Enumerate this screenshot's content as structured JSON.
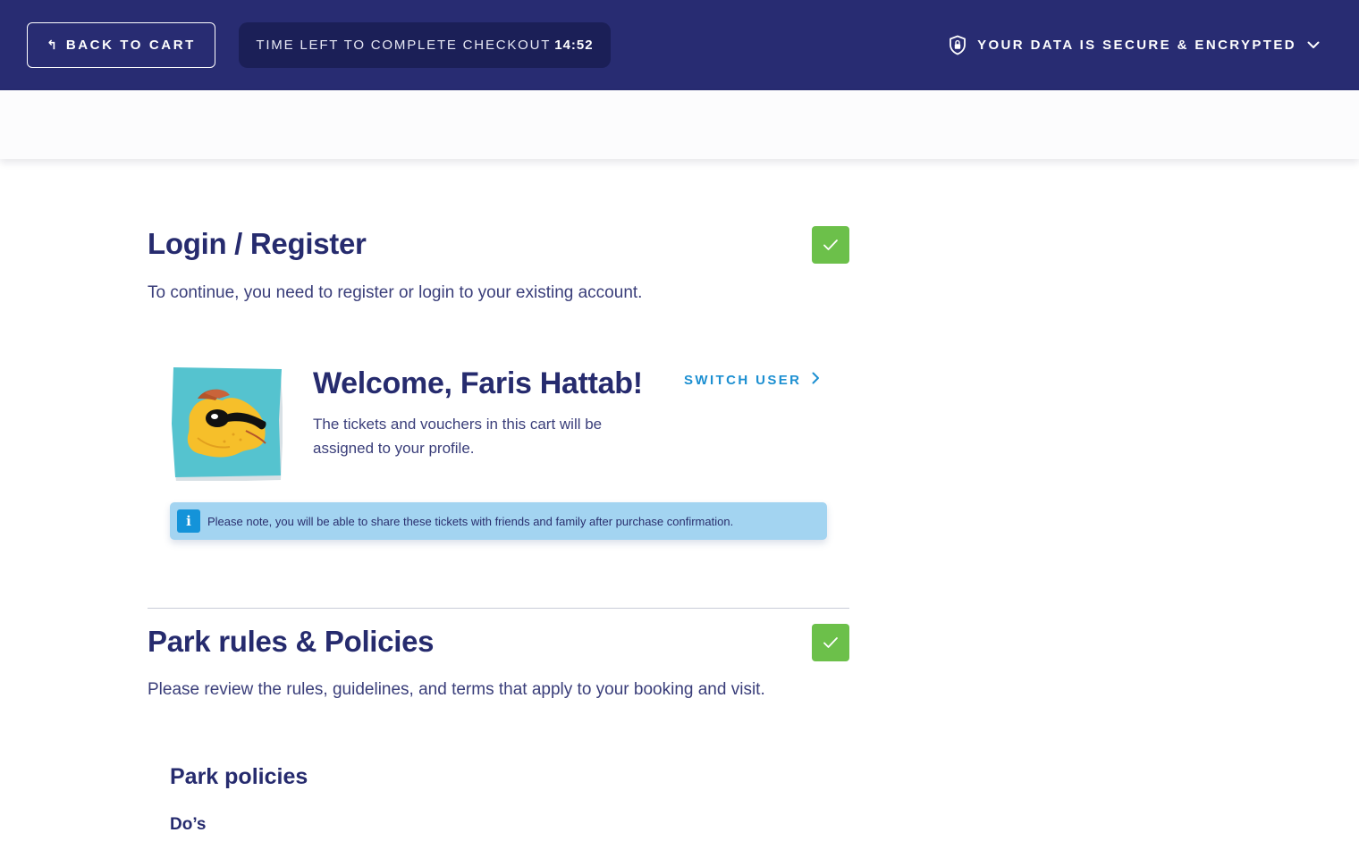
{
  "header": {
    "back_label": "BACK TO CART",
    "back_icon": "return-arrow-icon",
    "timer_label": "TIME LEFT TO COMPLETE CHECKOUT",
    "timer_value": "14:52",
    "secure_label": "YOUR DATA IS SECURE & ENCRYPTED",
    "secure_icon": "shield-lock-icon",
    "secure_chevron": "chevron-down-icon"
  },
  "login": {
    "title": "Login / Register",
    "description": "To continue, you need to register or login to your existing account.",
    "status": "complete",
    "welcome": "Welcome, Faris Hattab!",
    "welcome_sub": "The tickets and vouchers in this cart will be assigned to your profile.",
    "switch_label": "SWITCH USER",
    "notice": "Please note, you will be able to share these tickets with friends and family after purchase confirmation.",
    "notice_icon": "info-icon"
  },
  "policies": {
    "title": "Park rules & Policies",
    "description": "Please review the rules, guidelines, and terms that apply to your booking and visit.",
    "status": "complete",
    "subtitle": "Park policies",
    "subsection": "Do’s"
  },
  "colors": {
    "header_bg": "#282c72",
    "timer_bg": "#1b1f57",
    "accent_blue": "#1c8fd1",
    "success_green": "#6cc04a",
    "notice_bg": "#a3d4f1",
    "title_navy": "#262b6e"
  }
}
